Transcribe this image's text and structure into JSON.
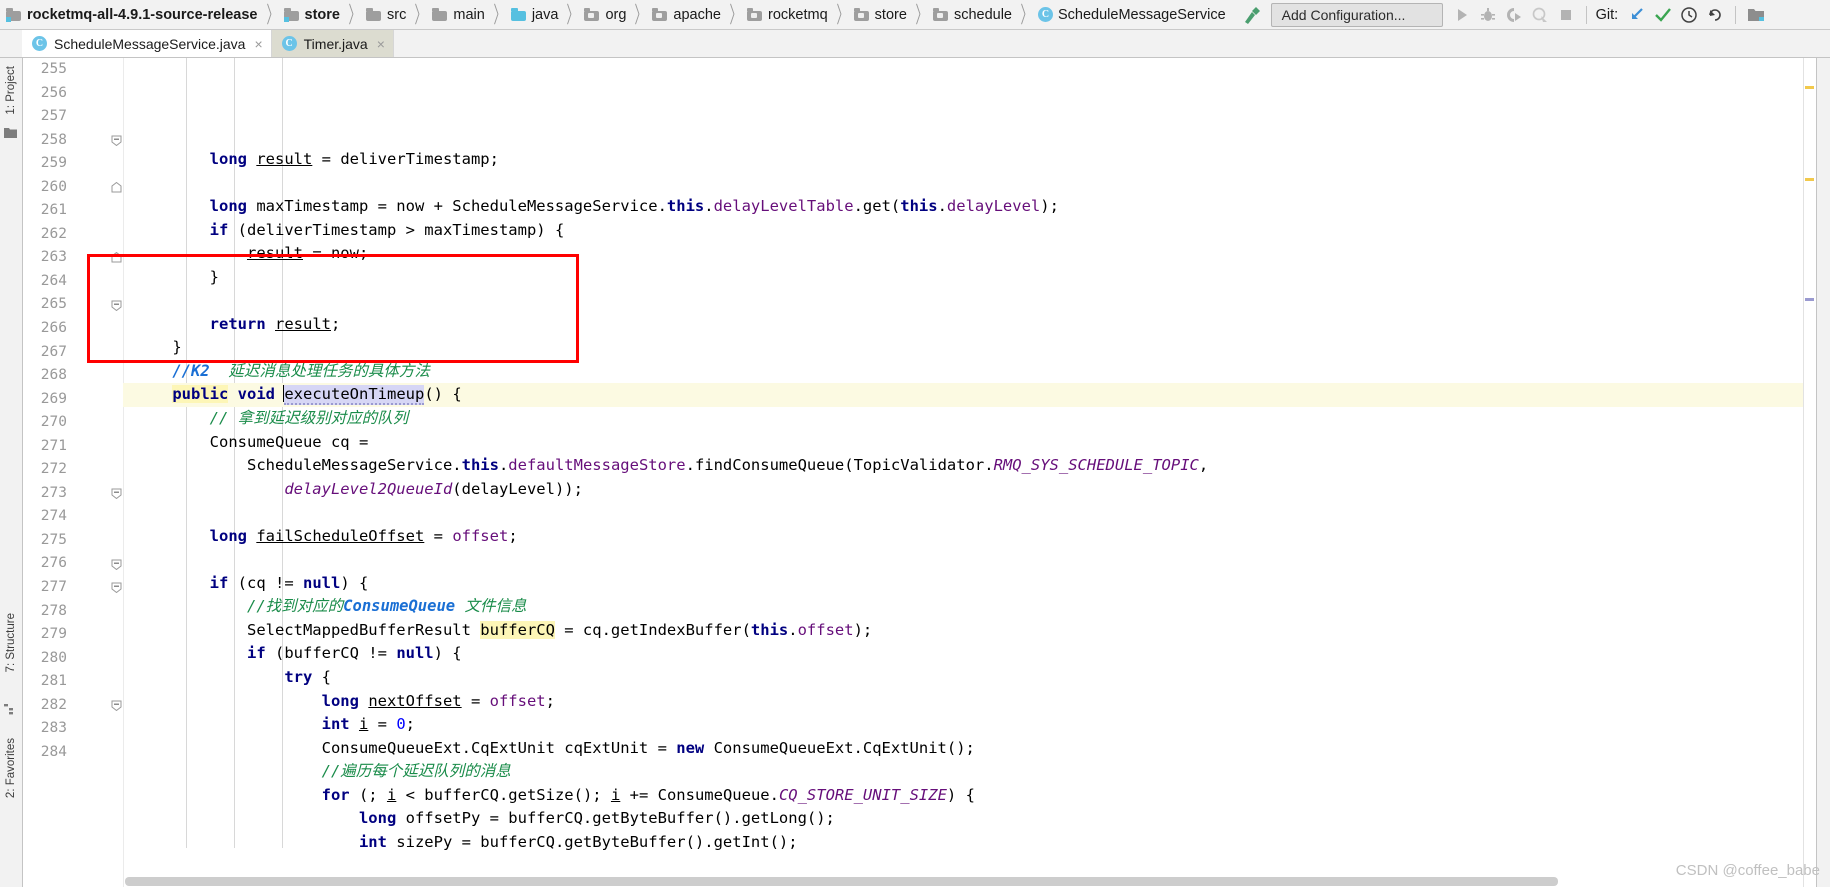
{
  "window": {
    "title": "rocketmq-all-4.9.1-source-release"
  },
  "breadcrumb": {
    "items": [
      {
        "label": "rocketmq-all-4.9.1-source-release",
        "icon": "module-folder-icon",
        "bold": true
      },
      {
        "label": "store",
        "icon": "module-folder-icon",
        "bold": true
      },
      {
        "label": "src",
        "icon": "folder-icon",
        "bold": false
      },
      {
        "label": "main",
        "icon": "folder-icon",
        "bold": false
      },
      {
        "label": "java",
        "icon": "source-folder-icon",
        "bold": false
      },
      {
        "label": "org",
        "icon": "package-icon",
        "bold": false
      },
      {
        "label": "apache",
        "icon": "package-icon",
        "bold": false
      },
      {
        "label": "rocketmq",
        "icon": "package-icon",
        "bold": false
      },
      {
        "label": "store",
        "icon": "package-icon",
        "bold": false
      },
      {
        "label": "schedule",
        "icon": "package-icon",
        "bold": false
      },
      {
        "label": "ScheduleMessageService",
        "icon": "java-class-icon",
        "bold": false
      }
    ],
    "separator": "〉"
  },
  "toolbar": {
    "make_project_icon": "hammer-icon",
    "run_configuration": "Add Configuration...",
    "run_icon": "play-icon",
    "debug_icon": "bug-icon",
    "run_with_coverage_icon": "run-coverage-icon",
    "profile_icon": "profiler-icon",
    "stop_icon": "stop-icon",
    "git_label": "Git:",
    "update_project_icon": "update-arrow-icon",
    "commit_icon": "checkmark-icon",
    "history_icon": "clock-icon",
    "rollback_icon": "undo-icon",
    "search_everywhere_icon": "project-icon"
  },
  "tabs": [
    {
      "label": "ScheduleMessageService.java",
      "icon": "java-class-icon",
      "active": true,
      "close": "×"
    },
    {
      "label": "Timer.java",
      "icon": "java-class-icon",
      "active": false,
      "close": "×"
    }
  ],
  "tool_windows": {
    "left": [
      {
        "label": "1: Project",
        "name": "project-tool-window"
      },
      {
        "label": "7: Structure",
        "name": "structure-tool-window"
      },
      {
        "label": "2: Favorites",
        "name": "favorites-tool-window"
      }
    ]
  },
  "editor": {
    "first_line_number": 255,
    "highlighted_line": 265,
    "annotation": {
      "color": "#ff0000",
      "shape": "rectangle",
      "covers_lines": [
        264,
        267
      ]
    },
    "lines": [
      {
        "n": 255,
        "fold": null,
        "tokens": [
          {
            "t": "        ",
            "c": "pln"
          },
          {
            "t": "long",
            "c": "kw"
          },
          {
            "t": " ",
            "c": "pln"
          },
          {
            "t": "result",
            "c": "loc under"
          },
          {
            "t": " = deliverTimestamp;",
            "c": "pln"
          }
        ]
      },
      {
        "n": 256,
        "fold": null,
        "tokens": []
      },
      {
        "n": 257,
        "fold": null,
        "tokens": [
          {
            "t": "        ",
            "c": "pln"
          },
          {
            "t": "long",
            "c": "kw"
          },
          {
            "t": " maxTimestamp = now + ScheduleMessageService.",
            "c": "pln"
          },
          {
            "t": "this",
            "c": "kw"
          },
          {
            "t": ".",
            "c": "pln"
          },
          {
            "t": "delayLevelTable",
            "c": "fldp"
          },
          {
            "t": ".get(",
            "c": "pln"
          },
          {
            "t": "this",
            "c": "kw"
          },
          {
            "t": ".",
            "c": "pln"
          },
          {
            "t": "delayLevel",
            "c": "fldp"
          },
          {
            "t": ");",
            "c": "pln"
          }
        ]
      },
      {
        "n": 258,
        "fold": "collapse",
        "tokens": [
          {
            "t": "        ",
            "c": "pln"
          },
          {
            "t": "if",
            "c": "kw"
          },
          {
            "t": " (deliverTimestamp > maxTimestamp) {",
            "c": "pln"
          }
        ]
      },
      {
        "n": 259,
        "fold": null,
        "tokens": [
          {
            "t": "            ",
            "c": "pln"
          },
          {
            "t": "result",
            "c": "loc under"
          },
          {
            "t": " = now;",
            "c": "pln"
          }
        ]
      },
      {
        "n": 260,
        "fold": "end",
        "tokens": [
          {
            "t": "        }",
            "c": "pln"
          }
        ]
      },
      {
        "n": 261,
        "fold": null,
        "tokens": []
      },
      {
        "n": 262,
        "fold": null,
        "tokens": [
          {
            "t": "        ",
            "c": "pln"
          },
          {
            "t": "return",
            "c": "kw"
          },
          {
            "t": " ",
            "c": "pln"
          },
          {
            "t": "result",
            "c": "loc under"
          },
          {
            "t": ";",
            "c": "pln"
          }
        ]
      },
      {
        "n": 263,
        "fold": "end",
        "tokens": [
          {
            "t": "    }",
            "c": "pln"
          }
        ]
      },
      {
        "n": 264,
        "fold": null,
        "tokens": [
          {
            "t": "    ",
            "c": "pln"
          },
          {
            "t": "//K2",
            "c": "cmtk"
          },
          {
            "t": "  延迟消息处理任务的具体方法",
            "c": "cmt"
          }
        ]
      },
      {
        "n": 265,
        "fold": "collapse",
        "highlight": true,
        "tokens": [
          {
            "t": "    ",
            "c": "pln"
          },
          {
            "t": "public",
            "c": "kw hlbox"
          },
          {
            "t": " ",
            "c": "pln"
          },
          {
            "t": "void",
            "c": "kw"
          },
          {
            "t": " ",
            "c": "pln"
          },
          {
            "t": "executeOnTimeup",
            "c": "mth sel wavy"
          },
          {
            "t": "() {",
            "c": "pln"
          }
        ]
      },
      {
        "n": 266,
        "fold": null,
        "tokens": [
          {
            "t": "        ",
            "c": "pln"
          },
          {
            "t": "// 拿到延迟级别对应的队列",
            "c": "cmt"
          }
        ]
      },
      {
        "n": 267,
        "fold": null,
        "tokens": [
          {
            "t": "        ConsumeQueue cq =",
            "c": "pln"
          }
        ]
      },
      {
        "n": 268,
        "fold": null,
        "tokens": [
          {
            "t": "            ScheduleMessageService.",
            "c": "pln"
          },
          {
            "t": "this",
            "c": "kw"
          },
          {
            "t": ".",
            "c": "pln"
          },
          {
            "t": "defaultMessageStore",
            "c": "fldp"
          },
          {
            "t": ".findConsumeQueue(TopicValidator.",
            "c": "pln"
          },
          {
            "t": "RMQ_SYS_SCHEDULE_TOPIC",
            "c": "stat"
          },
          {
            "t": ",",
            "c": "pln"
          }
        ]
      },
      {
        "n": 269,
        "fold": null,
        "tokens": [
          {
            "t": "                ",
            "c": "pln"
          },
          {
            "t": "delayLevel2QueueId",
            "c": "fld"
          },
          {
            "t": "(delayLevel));",
            "c": "pln"
          }
        ]
      },
      {
        "n": 270,
        "fold": null,
        "tokens": []
      },
      {
        "n": 271,
        "fold": null,
        "tokens": [
          {
            "t": "        ",
            "c": "pln"
          },
          {
            "t": "long",
            "c": "kw"
          },
          {
            "t": " ",
            "c": "pln"
          },
          {
            "t": "failScheduleOffset",
            "c": "loc under"
          },
          {
            "t": " = ",
            "c": "pln"
          },
          {
            "t": "offset",
            "c": "fldp"
          },
          {
            "t": ";",
            "c": "pln"
          }
        ]
      },
      {
        "n": 272,
        "fold": null,
        "tokens": []
      },
      {
        "n": 273,
        "fold": "collapse",
        "tokens": [
          {
            "t": "        ",
            "c": "pln"
          },
          {
            "t": "if",
            "c": "kw"
          },
          {
            "t": " (cq != ",
            "c": "pln"
          },
          {
            "t": "null",
            "c": "kw"
          },
          {
            "t": ") {",
            "c": "pln"
          }
        ]
      },
      {
        "n": 274,
        "fold": null,
        "tokens": [
          {
            "t": "            ",
            "c": "pln"
          },
          {
            "t": "//找到对应的",
            "c": "cmt"
          },
          {
            "t": "ConsumeQueue",
            "c": "cmtk"
          },
          {
            "t": " 文件信息",
            "c": "cmt"
          }
        ]
      },
      {
        "n": 275,
        "fold": null,
        "tokens": [
          {
            "t": "            SelectMappedBufferResult ",
            "c": "pln"
          },
          {
            "t": "bufferCQ",
            "c": "loc hlbox"
          },
          {
            "t": " = cq.getIndexBuffer(",
            "c": "pln"
          },
          {
            "t": "this",
            "c": "kw"
          },
          {
            "t": ".",
            "c": "pln"
          },
          {
            "t": "offset",
            "c": "fldp"
          },
          {
            "t": ");",
            "c": "pln"
          }
        ]
      },
      {
        "n": 276,
        "fold": "collapse",
        "tokens": [
          {
            "t": "            ",
            "c": "pln"
          },
          {
            "t": "if",
            "c": "kw"
          },
          {
            "t": " (bufferCQ != ",
            "c": "pln"
          },
          {
            "t": "null",
            "c": "kw"
          },
          {
            "t": ") {",
            "c": "pln"
          }
        ]
      },
      {
        "n": 277,
        "fold": "collapse",
        "tokens": [
          {
            "t": "                ",
            "c": "pln"
          },
          {
            "t": "try",
            "c": "kw"
          },
          {
            "t": " {",
            "c": "pln"
          }
        ]
      },
      {
        "n": 278,
        "fold": null,
        "tokens": [
          {
            "t": "                    ",
            "c": "pln"
          },
          {
            "t": "long",
            "c": "kw"
          },
          {
            "t": " ",
            "c": "pln"
          },
          {
            "t": "nextOffset",
            "c": "loc under"
          },
          {
            "t": " = ",
            "c": "pln"
          },
          {
            "t": "offset",
            "c": "fldp"
          },
          {
            "t": ";",
            "c": "pln"
          }
        ]
      },
      {
        "n": 279,
        "fold": null,
        "tokens": [
          {
            "t": "                    ",
            "c": "pln"
          },
          {
            "t": "int",
            "c": "kw"
          },
          {
            "t": " ",
            "c": "pln"
          },
          {
            "t": "i",
            "c": "loc under"
          },
          {
            "t": " = ",
            "c": "pln"
          },
          {
            "t": "0",
            "c": "num"
          },
          {
            "t": ";",
            "c": "pln"
          }
        ]
      },
      {
        "n": 280,
        "fold": null,
        "tokens": [
          {
            "t": "                    ConsumeQueueExt.CqExtUnit cqExtUnit = ",
            "c": "pln"
          },
          {
            "t": "new",
            "c": "kw"
          },
          {
            "t": " ConsumeQueueExt.CqExtUnit();",
            "c": "pln"
          }
        ]
      },
      {
        "n": 281,
        "fold": null,
        "tokens": [
          {
            "t": "                    ",
            "c": "pln"
          },
          {
            "t": "//遍历每个延迟队列的消息",
            "c": "cmt"
          }
        ]
      },
      {
        "n": 282,
        "fold": "collapse",
        "tokens": [
          {
            "t": "                    ",
            "c": "pln"
          },
          {
            "t": "for",
            "c": "kw"
          },
          {
            "t": " (; ",
            "c": "pln"
          },
          {
            "t": "i",
            "c": "loc under"
          },
          {
            "t": " < bufferCQ.getSize(); ",
            "c": "pln"
          },
          {
            "t": "i",
            "c": "loc under"
          },
          {
            "t": " += ConsumeQueue.",
            "c": "pln"
          },
          {
            "t": "CQ_STORE_UNIT_SIZE",
            "c": "stat"
          },
          {
            "t": ") {",
            "c": "pln"
          }
        ]
      },
      {
        "n": 283,
        "fold": null,
        "tokens": [
          {
            "t": "                        ",
            "c": "pln"
          },
          {
            "t": "long",
            "c": "kw"
          },
          {
            "t": " offsetPy = bufferCQ.getByteBuffer().getLong();",
            "c": "pln"
          }
        ]
      },
      {
        "n": 284,
        "fold": null,
        "tokens": [
          {
            "t": "                        ",
            "c": "pln"
          },
          {
            "t": "int",
            "c": "kw"
          },
          {
            "t": " sizePy = bufferCQ.getByteBuffer().getInt();",
            "c": "pln"
          }
        ]
      }
    ]
  },
  "watermark": {
    "text": "CSDN @coffee_babe"
  },
  "colors": {
    "accent_blue": "#56c0e0",
    "annotation_red": "#ff0000",
    "comment_green": "#1a8c4a",
    "keyword_navy": "#000080",
    "field_purple": "#660e7a",
    "highlight_yellow": "#fcfae2"
  }
}
